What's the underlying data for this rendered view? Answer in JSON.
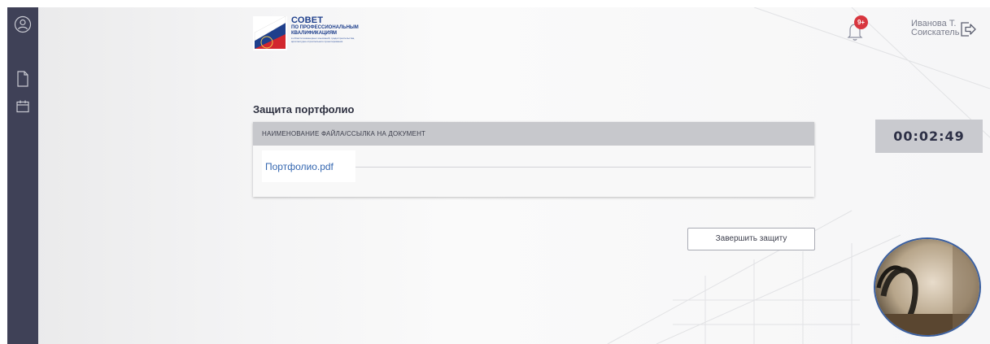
{
  "sidebar": {
    "items": [
      {
        "icon": "user-circle-icon"
      },
      {
        "icon": "document-icon"
      },
      {
        "icon": "calendar-icon"
      }
    ]
  },
  "header": {
    "logo": {
      "line1": "СОВЕТ",
      "line2": "ПО ПРОФЕССИОНАЛЬНЫМ",
      "line3": "КВАЛИФИКАЦИЯМ",
      "line4": "в области инженерных изысканий, градостроительства,",
      "line5": "архитектурно-строительного проектирования"
    },
    "notifications": {
      "icon": "bell-icon",
      "badge": "9+"
    },
    "user": {
      "name": "Иванова Т.",
      "role": "Соискатель"
    },
    "logout_icon": "logout-icon"
  },
  "main": {
    "title": "Защита портфолио",
    "table": {
      "column_header": "НАИМЕНОВАНИЕ ФАЙЛА/ССЫЛКА НА ДОКУМЕНТ",
      "rows": [
        {
          "file": "Портфолио.pdf"
        }
      ]
    },
    "finish_button": "Завершить защиту"
  },
  "timer": {
    "value": "00:02:49"
  },
  "colors": {
    "sidebar": "#3f4157",
    "accent": "#1e3f8c",
    "link": "#3567b0",
    "badge": "#d8363f",
    "table_header": "#c7c8cc"
  }
}
